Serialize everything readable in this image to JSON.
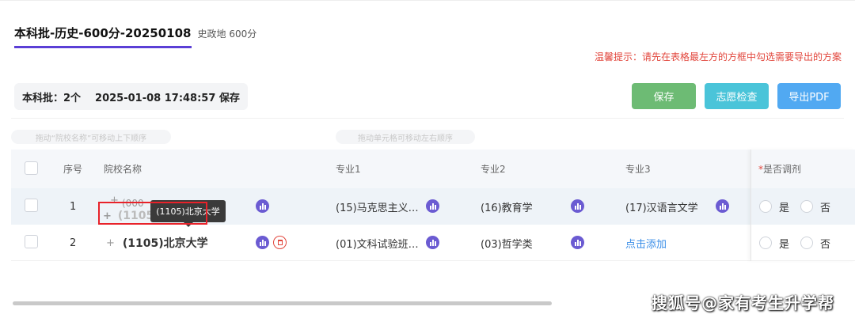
{
  "header": {
    "title": "本科批-历史-600分-20250108",
    "subtitle": "史政地 600分",
    "hint": "温馨提示：请先在表格最左方的方框中勾选需要导出的方案"
  },
  "status": {
    "batch_count": "本科批：2个",
    "saved_time": "2025-01-08 17:48:57 保存"
  },
  "buttons": {
    "save": "保存",
    "check": "志愿检查",
    "export_pdf": "导出PDF"
  },
  "drag_tips": {
    "school": "拖动“院校名称”可移动上下顺序",
    "cell": "拖动单元格可移动左右顺序"
  },
  "table": {
    "headers": {
      "index": "序号",
      "school": "院校名称",
      "major1": "专业1",
      "major2": "专业2",
      "major3": "专业3",
      "adjust_star": "*",
      "adjust": "是否调剂"
    },
    "rows": [
      {
        "index": "1",
        "plus": "+",
        "school_partial": "(000",
        "school": "(1105)北京大学",
        "major1": "(15)马克思主义…",
        "major2": "(16)教育学",
        "major3": "(17)汉语言文学",
        "yes": "是",
        "no": "否"
      },
      {
        "index": "2",
        "plus": "+",
        "school": "(1105)北京大学",
        "major1": "(01)文科试验班…",
        "major2": "(03)哲学类",
        "major3": "点击添加",
        "yes": "是",
        "no": "否"
      }
    ]
  },
  "drag_ghost": {
    "tooltip": "(1105)北京大学"
  },
  "watermark": "搜狐号@家有考生升学帮",
  "colors": {
    "accent": "#5b3fd6",
    "save": "#6dbb74",
    "check": "#4ac4d9",
    "pdf": "#51a9f2",
    "hint": "#e2463c",
    "link": "#3b8ee8",
    "highlight_box": "#e8222a"
  }
}
